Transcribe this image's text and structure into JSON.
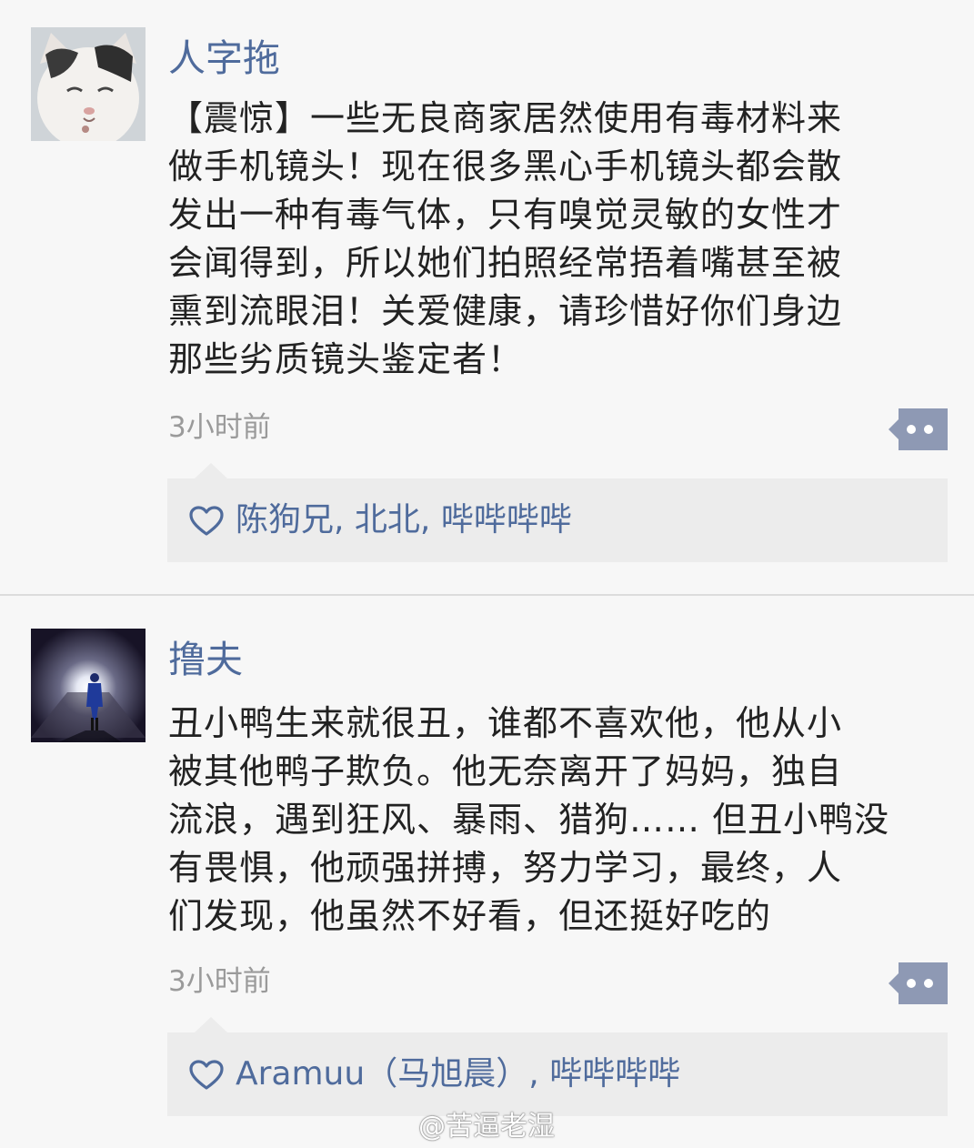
{
  "posts": [
    {
      "avatar": "cat-avatar-image",
      "username": "人字拖",
      "content_lines": [
        "【震惊】一些无良商家居然使用有毒材料来",
        "做手机镜头！现在很多黑心手机镜头都会散",
        "发出一种有毒气体，只有嗅觉灵敏的女性才",
        "会闻得到，所以她们拍照经常捂着嘴甚至被",
        "熏到流眼泪！关爱健康，请珍惜好你们身边",
        "那些劣质镜头鉴定者！"
      ],
      "time": "3小时前",
      "more_icon": "more-dots-icon",
      "like_icon": "heart-icon",
      "likes": "陈狗兄, 北北, 哔哔哔哔"
    },
    {
      "avatar": "night-figure-avatar-image",
      "username": "撸夫",
      "content_lines": [
        "丑小鸭生来就很丑，谁都不喜欢他，他从小",
        "被其他鸭子欺负。他无奈离开了妈妈，独自",
        "流浪，遇到狂风、暴雨、猎狗…… 但丑小鸭没",
        "有畏惧，他顽强拼搏，努力学习，最终，人",
        "们发现，他虽然不好看，但还挺好吃的"
      ],
      "time": "3小时前",
      "more_icon": "more-dots-icon",
      "like_icon": "heart-icon",
      "likes": "Aramuu（马旭晨）, 哔哔哔哔"
    }
  ],
  "watermark": "@苦逼老湿",
  "colors": {
    "name_blue": "#4f6b9c",
    "more_button": "#8e99b4",
    "likes_bg": "#ececec"
  }
}
